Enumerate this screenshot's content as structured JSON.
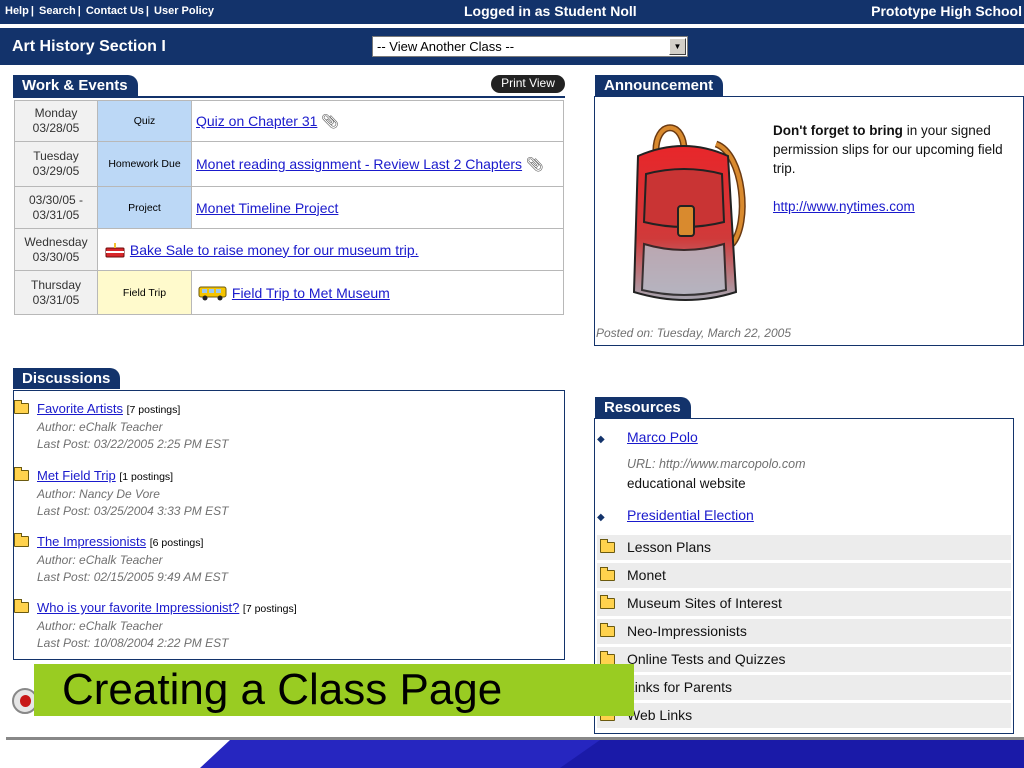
{
  "topbar": {
    "links": [
      "Help",
      "Search",
      "Contact Us",
      "User Policy"
    ],
    "login_status": "Logged in as Student Noll",
    "school": "Prototype High School"
  },
  "classbar": {
    "class_title": "Art History Section I",
    "class_select_value": "-- View Another Class --"
  },
  "work_events": {
    "title": "Work & Events",
    "print_view": "Print View",
    "rows": [
      {
        "date_line1": "Monday",
        "date_line2": "03/28/05",
        "type": "Quiz",
        "link": "Quiz on Chapter 31",
        "attachment": true
      },
      {
        "date_line1": "Tuesday",
        "date_line2": "03/29/05",
        "type": "Homework Due",
        "link": "Monet reading assignment - Review Last 2 Chapters",
        "attachment": true
      },
      {
        "date_line1": "03/30/05 -",
        "date_line2": "03/31/05",
        "type": "Project",
        "link": "Monet Timeline Project",
        "attachment": false
      },
      {
        "date_line1": "Wednesday",
        "date_line2": "03/30/05",
        "type": "",
        "link": "Bake Sale to raise money for our museum trip.",
        "icon": "cake-icon"
      },
      {
        "date_line1": "Thursday",
        "date_line2": "03/31/05",
        "type": "Field Trip",
        "link": "Field Trip to Met Museum",
        "icon": "bus-icon"
      }
    ]
  },
  "discussions": {
    "title": "Discussions",
    "items": [
      {
        "title": "Favorite Artists",
        "postings": "[7 postings]",
        "author": "Author: eChalk Teacher",
        "last_post": "Last Post: 03/22/2005 2:25 PM EST"
      },
      {
        "title": "Met Field Trip",
        "postings": "[1 postings]",
        "author": "Author: Nancy De Vore",
        "last_post": "Last Post: 03/25/2004 3:33 PM EST"
      },
      {
        "title": "The Impressionists",
        "postings": "[6 postings]",
        "author": "Author: eChalk Teacher",
        "last_post": "Last Post: 02/15/2005 9:49 AM EST"
      },
      {
        "title": "Who is your favorite Impressionist?",
        "postings": "[7 postings]",
        "author": "Author: eChalk Teacher",
        "last_post": "Last Post: 10/08/2004 2:22 PM EST"
      }
    ]
  },
  "announcement": {
    "title": "Announcement",
    "bold_text": "Don't forget to bring",
    "text": " in your signed permission slips for our upcoming field trip.",
    "link": "http://www.nytimes.com",
    "posted": "Posted on: Tuesday, March 22, 2005"
  },
  "resources": {
    "title": "Resources",
    "links": [
      {
        "label": "Marco Polo",
        "url_text": "URL: http://www.marcopolo.com",
        "description": "educational website"
      },
      {
        "label": "Presidential Election"
      }
    ],
    "folders": [
      "Lesson Plans",
      "Monet",
      "Museum Sites of Interest",
      "Neo-Impressionists",
      "Online Tests and Quizzes",
      "Links for Parents",
      "Web Links"
    ]
  },
  "caption": "Creating a Class Page",
  "colors": {
    "navy": "#13336b",
    "caption_green": "#99cc22",
    "link_blue": "#1a1acc",
    "type_blue": "#bcd8f6",
    "type_yellow": "#fffacc"
  }
}
